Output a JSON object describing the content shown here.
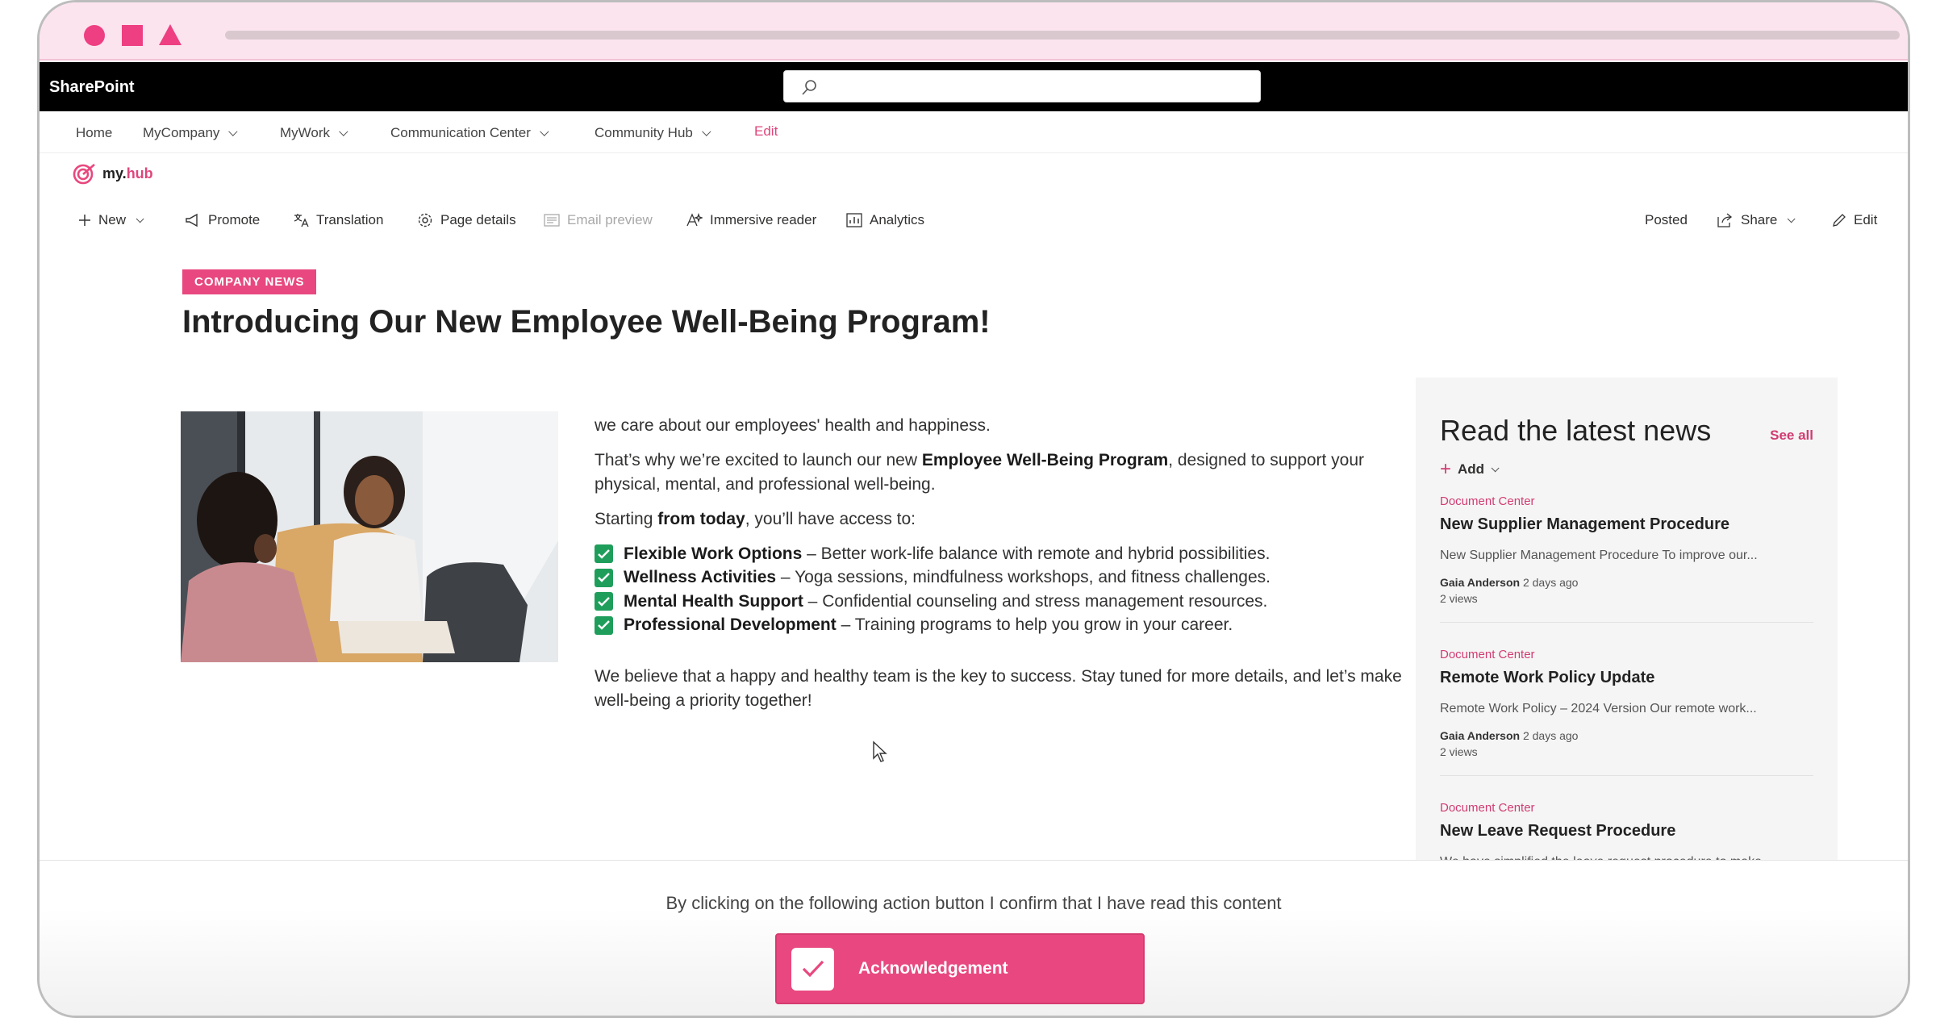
{
  "app": {
    "brand": "SharePoint"
  },
  "topnav": {
    "items": [
      "Home",
      "MyCompany",
      "MyWork",
      "Communication Center",
      "Community Hub"
    ],
    "edit": "Edit"
  },
  "logo": {
    "text_a": "my.",
    "text_b": "hub"
  },
  "commandbar": {
    "new": "New",
    "promote": "Promote",
    "translation": "Translation",
    "page_details": "Page details",
    "email_preview": "Email preview",
    "immersive_reader": "Immersive reader",
    "analytics": "Analytics",
    "posted": "Posted",
    "share": "Share",
    "edit": "Edit"
  },
  "article": {
    "badge": "COMPANY NEWS",
    "title": "Introducing Our New Employee Well-Being Program!",
    "p1": "we care about our employees' health and happiness.",
    "p2_a": "That’s why we’re excited to launch our new ",
    "p2_b": "Employee Well-Being Program",
    "p2_c": ", designed to support your physical, mental, and professional well-being.",
    "p3_a": "Starting ",
    "p3_b": "from today",
    "p3_c": ", you’ll have access to:",
    "list": [
      {
        "bold": "Flexible Work Options",
        "text": " – Better work-life balance with remote and hybrid possibilities."
      },
      {
        "bold": "Wellness Activities",
        "text": " – Yoga sessions, mindfulness workshops, and fitness challenges."
      },
      {
        "bold": "Mental Health Support",
        "text": " – Confidential counseling and stress management resources."
      },
      {
        "bold": "Professional Development",
        "text": " – Training programs to help you grow in your career."
      }
    ],
    "closing": "We believe that a happy and healthy team is the key to success. Stay tuned for more details, and let’s make well-being a priority together!"
  },
  "sidebar": {
    "title": "Read the latest news",
    "see_all": "See all",
    "add": "Add",
    "news": [
      {
        "category": "Document Center",
        "title": "New Supplier Management Procedure",
        "excerpt": "New Supplier Management Procedure To improve our...",
        "author": "Gaia Anderson",
        "time": "2 days ago",
        "views": "2 views"
      },
      {
        "category": "Document Center",
        "title": "Remote Work Policy Update",
        "excerpt": "Remote Work Policy – 2024 Version Our remote work...",
        "author": "Gaia Anderson",
        "time": "2 days ago",
        "views": "2 views"
      },
      {
        "category": "Document Center",
        "title": "New Leave Request Procedure",
        "excerpt": "We have simplified the leave request procedure to make...",
        "author": "",
        "time": "",
        "views": ""
      }
    ]
  },
  "footer": {
    "confirm_text": "By clicking on the following action button I confirm that I have read this content",
    "button_label": "Acknowledgement"
  },
  "colors": {
    "accent": "#e8487f",
    "check": "#1e9e5a",
    "suitebar": "#000000"
  }
}
